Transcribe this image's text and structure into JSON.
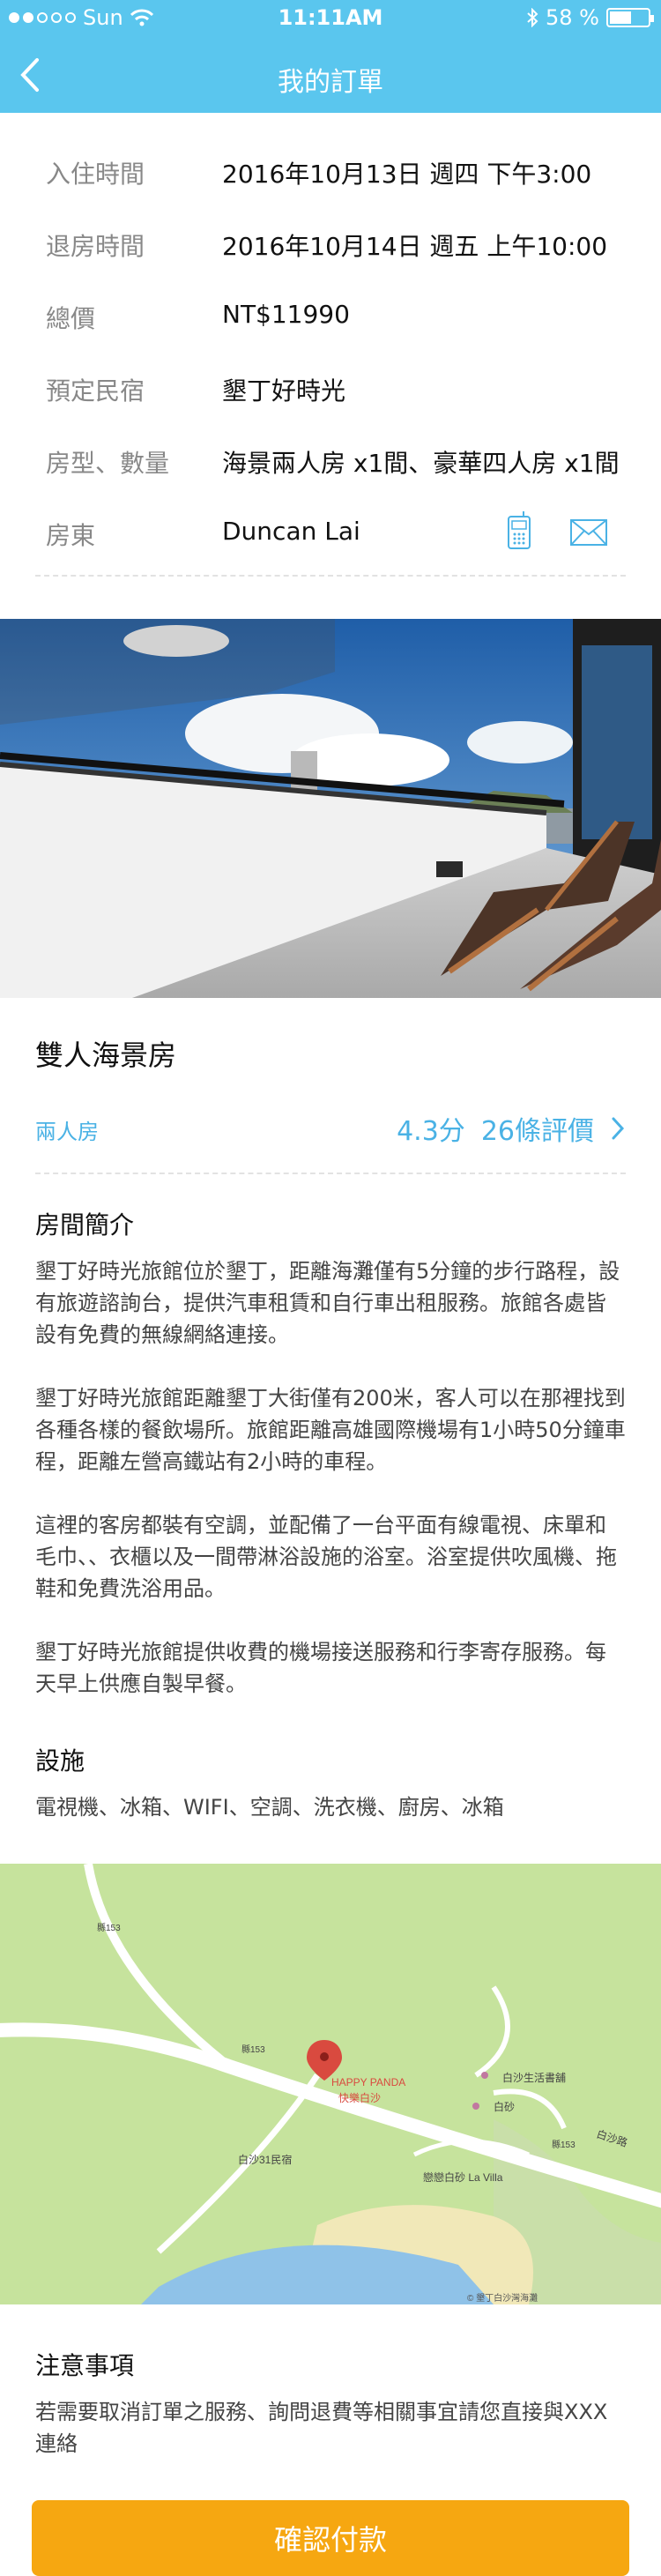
{
  "status_bar": {
    "carrier": "Sun",
    "time": "11:11AM",
    "battery": "58 %",
    "battery_level": 0.58
  },
  "nav": {
    "title": "我的訂單"
  },
  "booking": {
    "rows": [
      {
        "label": "入住時間",
        "value": "2016年10月13日 週四 下午3:00"
      },
      {
        "label": "退房時間",
        "value": "2016年10月14日 週五 上午10:00"
      },
      {
        "label": "總價",
        "value": "NT$11990"
      },
      {
        "label": "預定民宿",
        "value": "墾丁好時光"
      },
      {
        "label": "房型、數量",
        "value": "海景兩人房 x1間、豪華四人房 x1間"
      },
      {
        "label": "房東",
        "value": "Duncan Lai"
      }
    ]
  },
  "room": {
    "title": "雙人海景房",
    "type": "兩人房",
    "score": "4.3分",
    "reviews": "26條評價"
  },
  "intro": {
    "heading": "房間簡介",
    "paragraphs": [
      "墾丁好時光旅館位於墾丁，距離海灘僅有5分鐘的步行路程，設有旅遊諮詢台，提供汽車租賃和自行車出租服務。旅館各處皆設有免費的無線網絡連接。",
      "墾丁好時光旅館距離墾丁大街僅有200米，客人可以在那裡找到各種各樣的餐飲場所。旅館距離高雄國際機場有1小時50分鐘車程，距離左營高鐵站有2小時的車程。",
      "這裡的客房都裝有空調，並配備了一台平面有線電視、床單和毛巾、、衣櫃以及一間帶淋浴設施的浴室。浴室提供吹風機、拖鞋和免費洗浴用品。",
      "墾丁好時光旅館提供收費的機場接送服務和行李寄存服務。每天早上供應自製早餐。"
    ]
  },
  "facilities": {
    "heading": "設施",
    "list": "電視機、冰箱、WIFI、空調、洗衣機、廚房、冰箱"
  },
  "map": {
    "marker_label_en": "HAPPY PANDA",
    "marker_label_zh": "快樂白沙",
    "place_1": "白沙生活書舖",
    "place_2": "白砂",
    "place_3": "白沙31民宿",
    "place_4": "戀戀白砂 La Villa",
    "road_1": "縣153",
    "road_2": "縣153",
    "road_3": "縣153",
    "road_4": "白沙路",
    "copyright": "© 墾丁白沙灣海灘"
  },
  "notice": {
    "heading": "注意事項",
    "text": "若需要取消訂單之服務、詢問退費等相關事宜請您直接與XXX連絡"
  },
  "actions": {
    "pay_label": "確認付款"
  },
  "colors": {
    "header": "#5ac6ee",
    "accent": "#4ab2e5",
    "pay_button": "#f6a711"
  }
}
